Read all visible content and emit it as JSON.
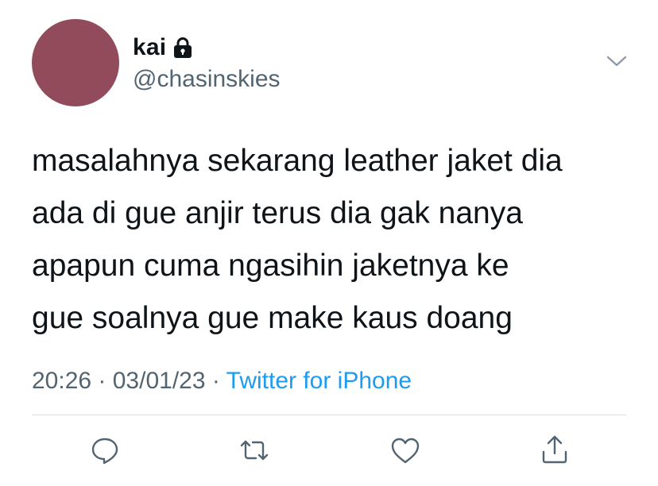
{
  "author": {
    "display_name": "kai",
    "handle": "@chasinskies",
    "avatar_color": "#924b5b",
    "protected_icon": "lock-icon"
  },
  "tweet": {
    "lines": [
      "masalahnya sekarang leather jaket dia",
      "ada di gue anjir terus dia gak nanya",
      "apapun cuma ngasihin jaketnya ke",
      "gue soalnya gue make kaus doang"
    ]
  },
  "meta": {
    "time": "20:26",
    "separator": " · ",
    "date": "03/01/23",
    "source": "Twitter for iPhone"
  },
  "colors": {
    "text": "#0f1419",
    "secondary": "#536471",
    "link": "#1d9bf0"
  },
  "actions": [
    "reply-icon",
    "retweet-icon",
    "like-icon",
    "share-icon"
  ]
}
